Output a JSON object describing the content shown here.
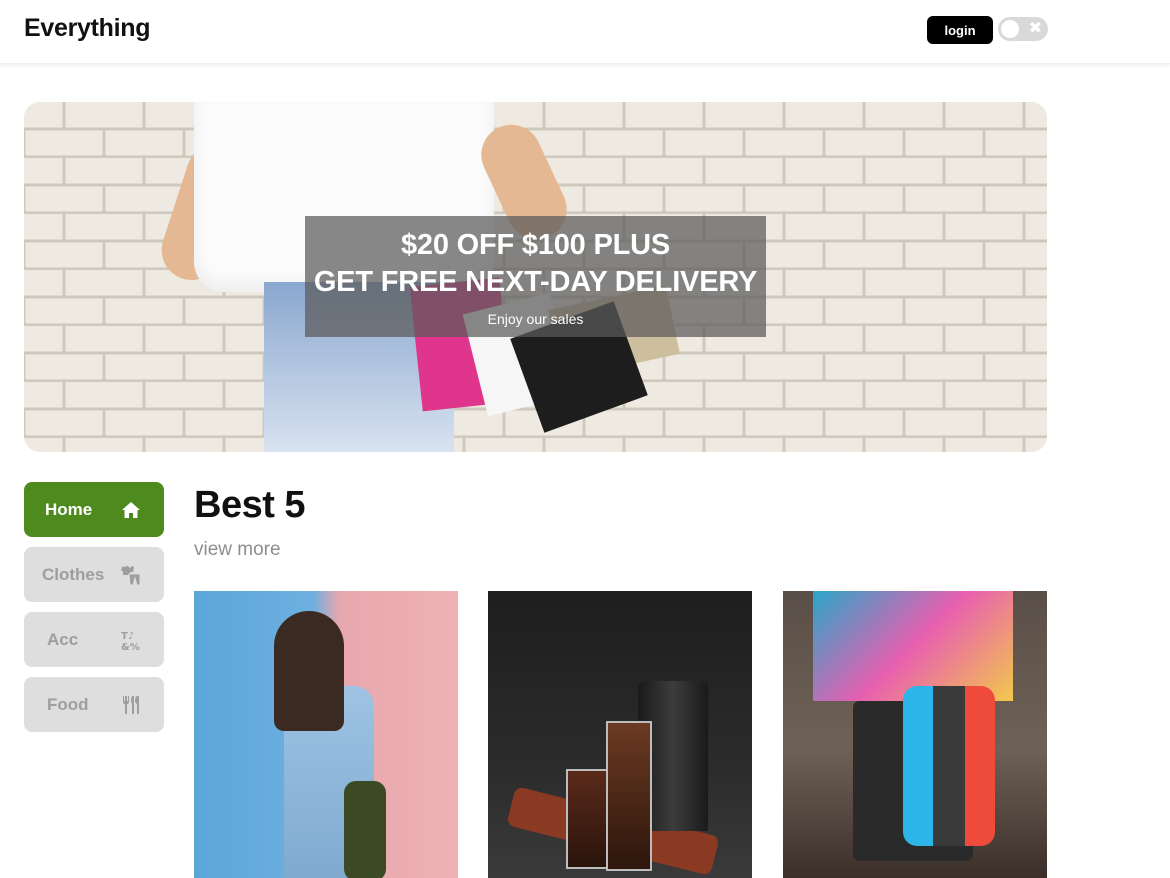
{
  "header": {
    "logo": "Everything",
    "login_label": "login",
    "toggle_icon": "close-icon"
  },
  "banner": {
    "title_line1": "$20 OFF $100 PLUS",
    "title_line2": "GET FREE NEXT-DAY DELIVERY",
    "subtitle": "Enjoy our sales"
  },
  "sidebar": {
    "items": [
      {
        "label": "Home",
        "icon": "home-icon",
        "active": true
      },
      {
        "label": "Clothes",
        "icon": "clothes-icon",
        "active": false
      },
      {
        "label": "Acc",
        "icon": "accessories-icon",
        "active": false
      },
      {
        "label": "Food",
        "icon": "utensils-icon",
        "active": false
      }
    ]
  },
  "main": {
    "section_title": "Best 5",
    "view_more": "view more"
  },
  "colors": {
    "accent_green": "#4f8a1e",
    "inactive_gray": "#dedede",
    "text_muted": "#8d8d8d"
  }
}
